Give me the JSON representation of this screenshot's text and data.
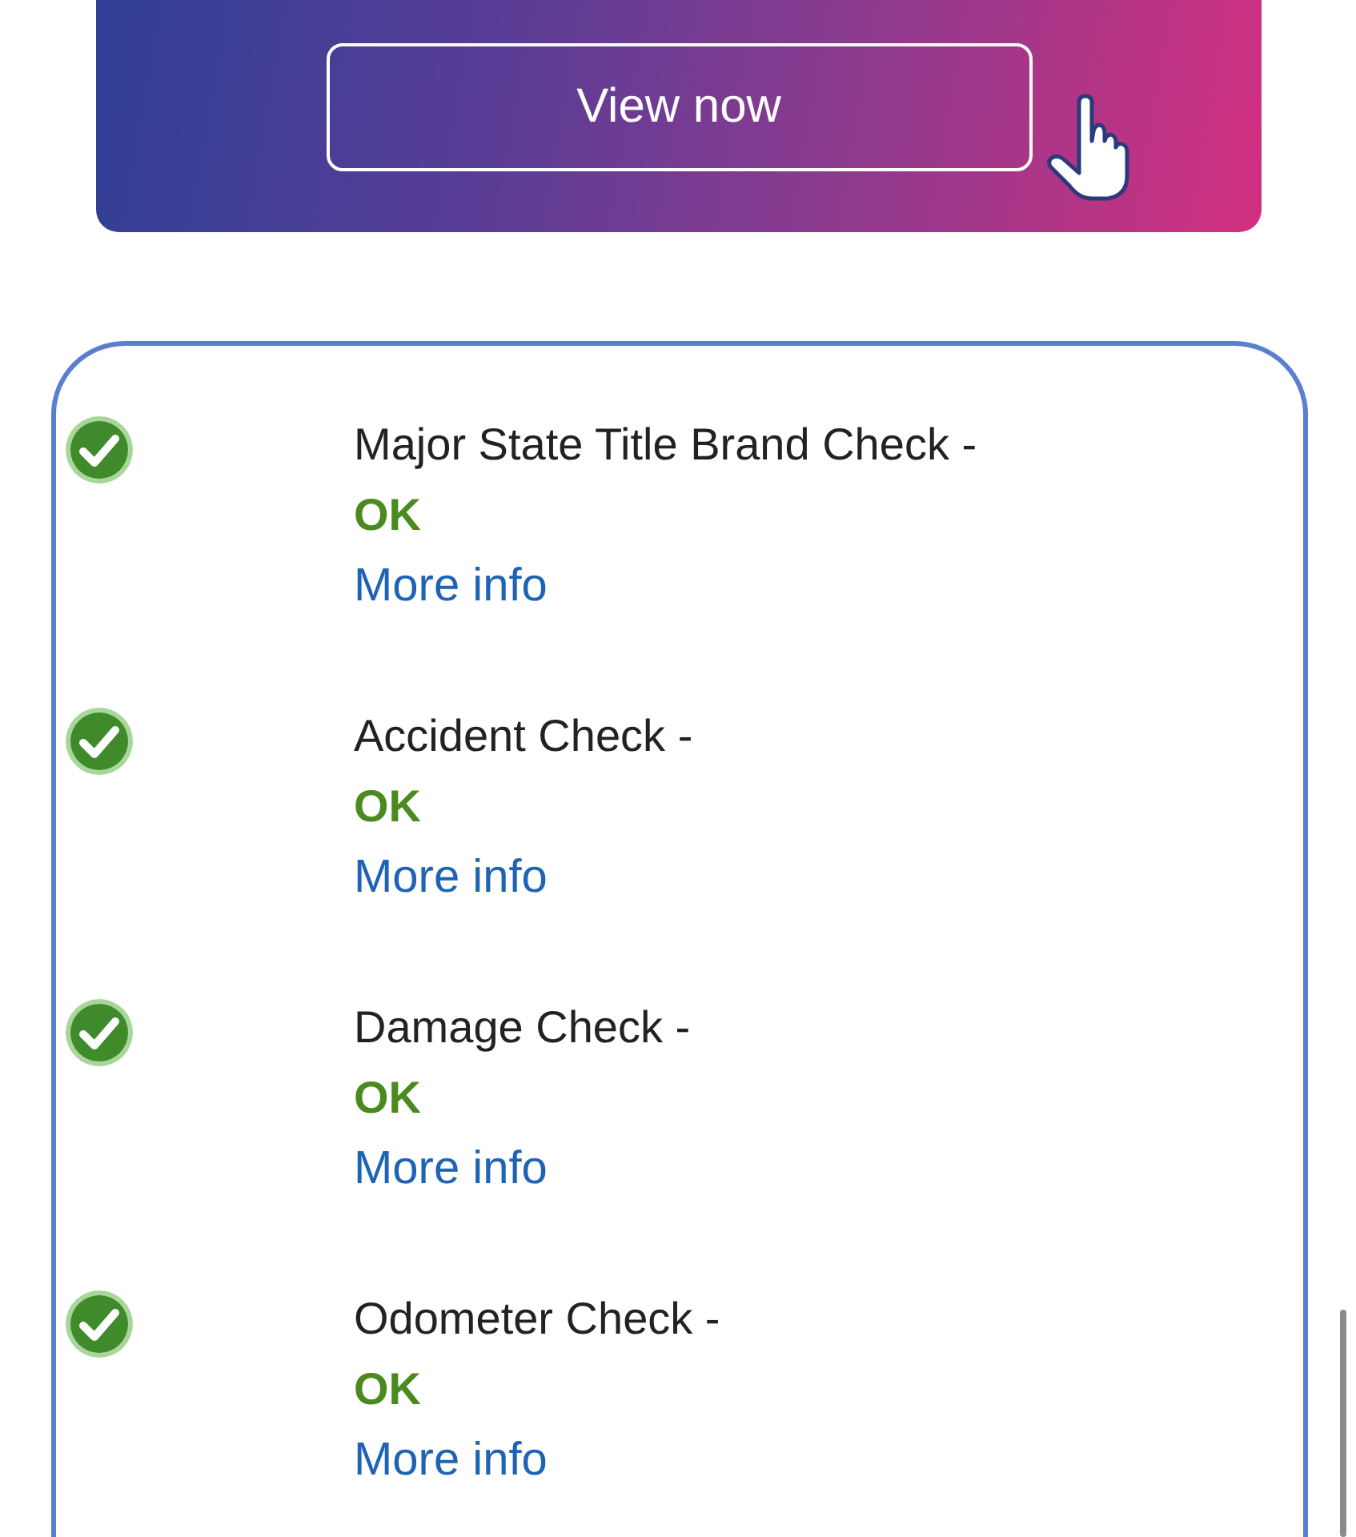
{
  "banner": {
    "button": "View now"
  },
  "checks": [
    {
      "title": "Major State Title Brand Check -",
      "status": "OK",
      "passed": true,
      "link": "More info"
    },
    {
      "title": "Accident Check -",
      "status": "OK",
      "passed": true,
      "link": "More info"
    },
    {
      "title": "Damage Check -",
      "status": "OK",
      "passed": true,
      "link": "More info"
    },
    {
      "title": "Odometer Check -",
      "status": "OK",
      "passed": true,
      "link": "More info"
    }
  ]
}
